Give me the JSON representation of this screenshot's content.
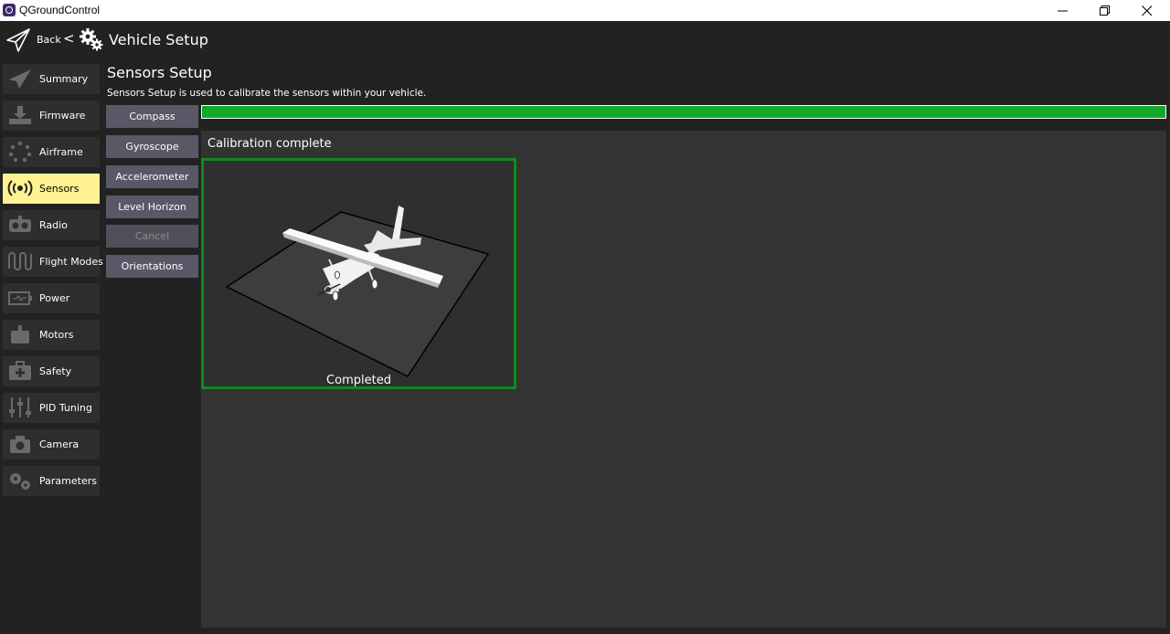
{
  "window": {
    "title": "QGroundControl"
  },
  "header": {
    "back_label": "Back",
    "separator": "<",
    "title": "Vehicle Setup"
  },
  "sidebar": {
    "items": [
      {
        "label": "Summary",
        "icon": "paper-plane-icon",
        "active": false
      },
      {
        "label": "Firmware",
        "icon": "download-icon",
        "active": false
      },
      {
        "label": "Airframe",
        "icon": "airframe-dots-icon",
        "active": false
      },
      {
        "label": "Sensors",
        "icon": "radio-waves-icon",
        "active": true
      },
      {
        "label": "Radio",
        "icon": "remote-control-icon",
        "active": false
      },
      {
        "label": "Flight Modes",
        "icon": "wave-icon",
        "active": false
      },
      {
        "label": "Power",
        "icon": "battery-icon",
        "active": false
      },
      {
        "label": "Motors",
        "icon": "motor-icon",
        "active": false
      },
      {
        "label": "Safety",
        "icon": "first-aid-kit-icon",
        "active": false
      },
      {
        "label": "PID Tuning",
        "icon": "sliders-icon",
        "active": false
      },
      {
        "label": "Camera",
        "icon": "camera-icon",
        "active": false
      },
      {
        "label": "Parameters",
        "icon": "gears-icon",
        "active": false
      }
    ]
  },
  "main": {
    "title": "Sensors Setup",
    "description": "Sensors Setup is used to calibrate the sensors within your vehicle.",
    "buttons": [
      {
        "label": "Compass",
        "enabled": true
      },
      {
        "label": "Gyroscope",
        "enabled": true
      },
      {
        "label": "Accelerometer",
        "enabled": true
      },
      {
        "label": "Level Horizon",
        "enabled": true
      },
      {
        "label": "Cancel",
        "enabled": false
      },
      {
        "label": "Orientations",
        "enabled": true
      }
    ],
    "progress": 1.0,
    "status": "Calibration complete",
    "orientation_box": {
      "label": "Completed",
      "state": "completed"
    }
  },
  "colors": {
    "progress": "#13a82b",
    "active_nav": "#fff291",
    "completed_border": "#0f8a1d",
    "button": "#585866"
  }
}
